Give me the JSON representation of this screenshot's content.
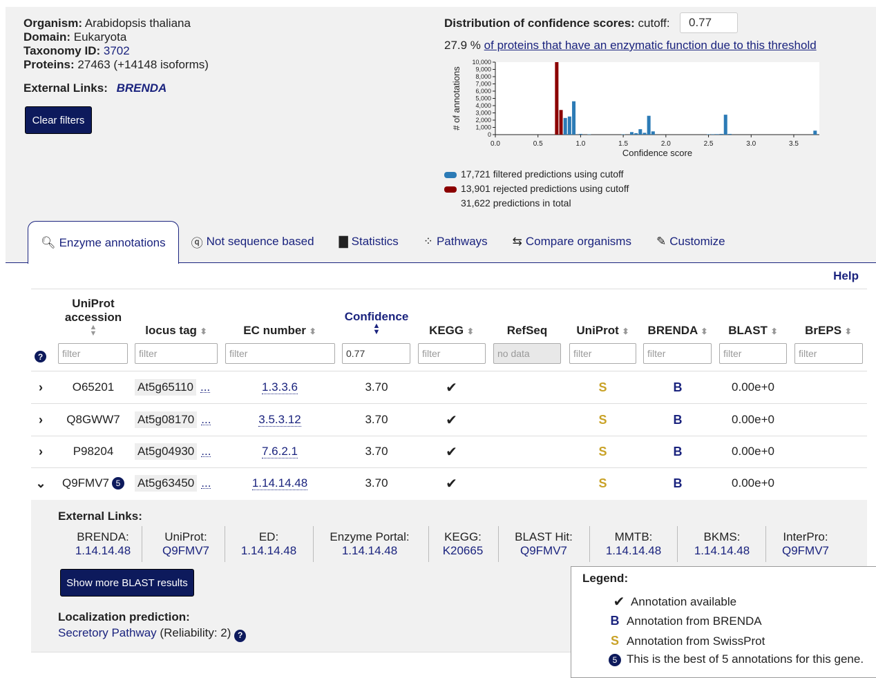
{
  "organism": {
    "organism_label": "Organism:",
    "organism_value": "Arabidopsis thaliana",
    "domain_label": "Domain:",
    "domain_value": "Eukaryota",
    "taxonomy_label": "Taxonomy ID:",
    "taxonomy_value": "3702",
    "proteins_label": "Proteins:",
    "proteins_value": "27463 (+14148 isoforms)",
    "external_links_label": "External Links:",
    "brenda_logo_text": "BRENDA",
    "clear_filters_label": "Clear filters"
  },
  "distribution": {
    "title": "Distribution of confidence scores:",
    "cutoff_label": "cutoff:",
    "cutoff_value": "0.77",
    "percent": "27.9 %",
    "percent_link": "of proteins that have an enzymatic function due to this threshold",
    "legend_filtered": "17,721 filtered predictions using cutoff",
    "legend_rejected": "13,901 rejected predictions using cutoff",
    "legend_total": "31,622 predictions in total"
  },
  "chart_data": {
    "type": "bar",
    "xlabel": "Confidence score",
    "ylabel": "# of annotations",
    "xlim": [
      0.0,
      3.8
    ],
    "ylim": [
      0,
      10000
    ],
    "x_ticks": [
      "0.0",
      "0.5",
      "1.0",
      "1.5",
      "2.0",
      "2.5",
      "3.0",
      "3.5"
    ],
    "y_ticks": [
      "0",
      "1,000",
      "2,000",
      "3,000",
      "4,000",
      "5,000",
      "6,000",
      "7,000",
      "8,000",
      "9,000",
      "10,000"
    ],
    "colors": {
      "filtered": "#2c7bb6",
      "rejected": "#8b0000"
    },
    "series": [
      {
        "name": "rejected",
        "x": [
          0.72,
          0.77
        ],
        "values": [
          10000,
          3400
        ]
      },
      {
        "name": "filtered",
        "x": [
          0.82,
          0.87,
          0.92,
          1.0,
          1.1,
          1.5,
          1.6,
          1.65,
          1.7,
          1.75,
          1.8,
          1.85,
          2.5,
          2.55,
          2.6,
          2.65,
          2.7,
          2.75,
          3.75
        ],
        "values": [
          2300,
          2500,
          4600,
          100,
          50,
          50,
          350,
          200,
          750,
          250,
          2600,
          450,
          50,
          60,
          70,
          100,
          2750,
          100,
          550
        ]
      }
    ]
  },
  "tabs": [
    {
      "icon": "enzyme-search-icon",
      "glyph": "🔍",
      "label": "Enzyme annotations"
    },
    {
      "icon": "question-search-icon",
      "glyph": "?",
      "label": "Not sequence based"
    },
    {
      "icon": "bar-chart-icon",
      "glyph": "📊",
      "label": "Statistics"
    },
    {
      "icon": "network-icon",
      "glyph": "⁘",
      "label": "Pathways"
    },
    {
      "icon": "compare-arrows-icon",
      "glyph": "⇆",
      "label": "Compare organisms"
    },
    {
      "icon": "edit-icon",
      "glyph": "✎",
      "label": "Customize"
    }
  ],
  "help_label": "Help",
  "table": {
    "headers": {
      "uniprot_accession": "UniProt accession",
      "locus_tag": "locus tag",
      "ec_number": "EC number",
      "confidence": "Confidence",
      "kegg": "KEGG",
      "refseq": "RefSeq",
      "uniprot": "UniProt",
      "brenda": "BRENDA",
      "blast": "BLAST",
      "breps": "BrEPS"
    },
    "filters": {
      "uniprot_accession": "filter",
      "locus_tag": "filter",
      "ec_number": "filter",
      "confidence": "0.77",
      "kegg": "filter",
      "refseq": "no data",
      "uniprot": "filter",
      "brenda": "filter",
      "blast": "filter",
      "breps": "filter"
    },
    "rows": [
      {
        "expand": "›",
        "accession": "O65201",
        "locus": "At5g65110",
        "ellipsis": "...",
        "ec": "1.3.3.6",
        "confidence": "3.70",
        "kegg": "✔",
        "uniprot": "S",
        "brenda": "B",
        "blast": "0.00e+0"
      },
      {
        "expand": "›",
        "accession": "Q8GWW7",
        "locus": "At5g08170",
        "ellipsis": "...",
        "ec": "3.5.3.12",
        "confidence": "3.70",
        "kegg": "✔",
        "uniprot": "S",
        "brenda": "B",
        "blast": "0.00e+0"
      },
      {
        "expand": "›",
        "accession": "P98204",
        "locus": "At5g04930",
        "ellipsis": "...",
        "ec": "7.6.2.1",
        "confidence": "3.70",
        "kegg": "✔",
        "uniprot": "S",
        "brenda": "B",
        "blast": "0.00e+0"
      },
      {
        "expand": "⌄",
        "accession": "Q9FMV7",
        "badge": "5",
        "locus": "At5g63450",
        "ellipsis": "...",
        "ec": "1.14.14.48",
        "confidence": "3.70",
        "kegg": "✔",
        "uniprot": "S",
        "brenda": "B",
        "blast": "0.00e+0"
      }
    ]
  },
  "detail": {
    "external_links_title": "External Links:",
    "links": [
      {
        "label": "BRENDA:",
        "value": "1.14.14.48"
      },
      {
        "label": "UniProt:",
        "value": "Q9FMV7"
      },
      {
        "label": "ED:",
        "value": "1.14.14.48"
      },
      {
        "label": "Enzyme Portal:",
        "value": "1.14.14.48"
      },
      {
        "label": "KEGG:",
        "value": "K20665"
      },
      {
        "label": "BLAST Hit:",
        "value": "Q9FMV7"
      },
      {
        "label": "MMTB:",
        "value": "1.14.14.48"
      },
      {
        "label": "BKMS:",
        "value": "1.14.14.48"
      },
      {
        "label": "InterPro:",
        "value": "Q9FMV7"
      }
    ],
    "blast_button": "Show more BLAST results",
    "localization_title": "Localization prediction:",
    "localization_link": "Secretory Pathway",
    "localization_reliability": "(Reliability: 2)"
  },
  "legend": {
    "title": "Legend:",
    "items": [
      {
        "symbol": "✔",
        "text": "Annotation available"
      },
      {
        "symbol": "B",
        "text": "Annotation from BRENDA"
      },
      {
        "symbol": "S",
        "text": "Annotation from SwissProt"
      },
      {
        "symbol": "5",
        "text": "This is the best of 5 annotations for this gene."
      }
    ]
  }
}
